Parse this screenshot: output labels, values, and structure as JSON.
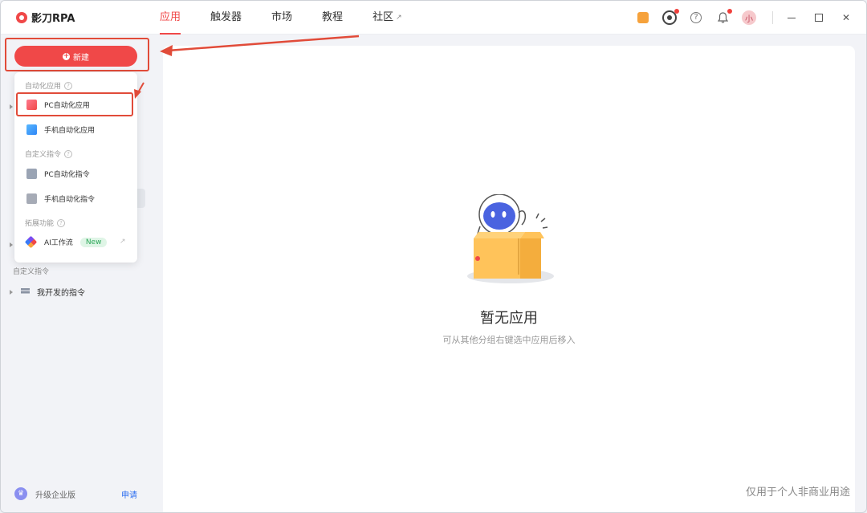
{
  "app": {
    "name": "影刀RPA"
  },
  "nav": {
    "tabs": [
      {
        "label": "应用",
        "active": true
      },
      {
        "label": "触发器",
        "active": false
      },
      {
        "label": "市场",
        "active": false
      },
      {
        "label": "教程",
        "active": false
      },
      {
        "label": "社区",
        "active": false
      }
    ]
  },
  "titlebar": {
    "avatar_text": "小",
    "icons": [
      "gift-icon",
      "eye-icon",
      "help-icon",
      "bell-icon",
      "avatar",
      "minimize-icon",
      "maximize-icon",
      "close-icon"
    ]
  },
  "sidebar": {
    "new_button": "新建",
    "dropdown": {
      "sections": [
        {
          "title": "自动化应用",
          "items": [
            {
              "label": "PC自动化应用",
              "icon": "pc-app-icon"
            },
            {
              "label": "手机自动化应用",
              "icon": "mobile-app-icon"
            }
          ]
        },
        {
          "title": "自定义指令",
          "items": [
            {
              "label": "PC自动化指令",
              "icon": "pc-command-icon"
            },
            {
              "label": "手机自动化指令",
              "icon": "mobile-command-icon"
            }
          ]
        },
        {
          "title": "拓展功能",
          "items": [
            {
              "label": "AI工作流",
              "icon": "ai-workflow-icon",
              "badge": "New"
            }
          ]
        }
      ]
    },
    "custom_commands_label": "自定义指令",
    "my_commands": "我开发的指令",
    "upgrade_label": "升级企业版",
    "apply_label": "申请"
  },
  "main": {
    "empty_title": "暂无应用",
    "empty_subtitle": "可从其他分组右键选中应用后移入"
  },
  "watermark": "仅用于个人非商业用途",
  "colors": {
    "accent": "#f04848",
    "annotation": "#e14b39",
    "link": "#2f6ff0",
    "new_badge_bg": "#dff5e6",
    "new_badge_text": "#2ea85a"
  }
}
